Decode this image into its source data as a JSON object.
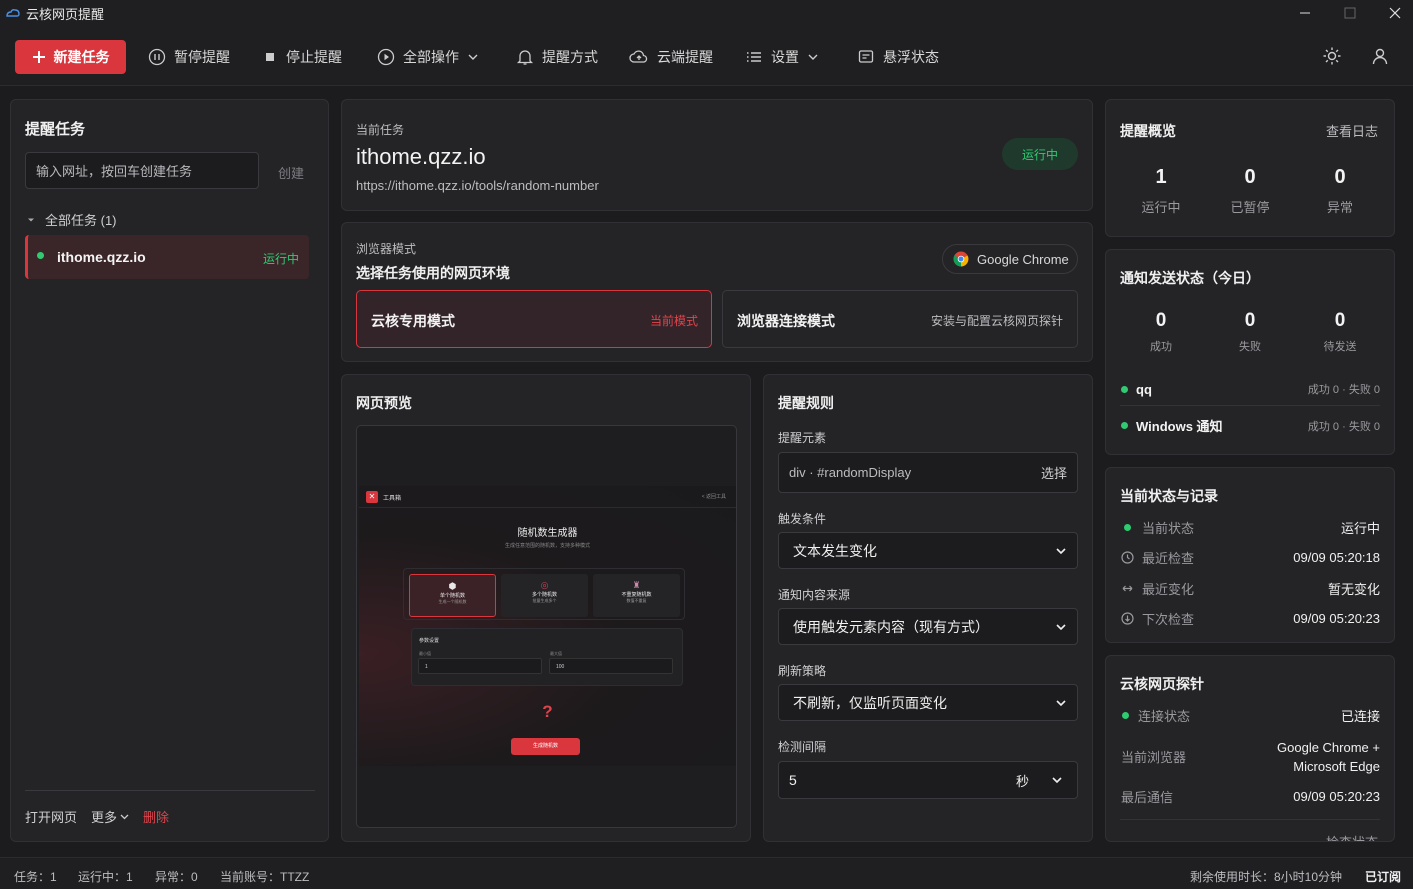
{
  "app": {
    "title": "云核网页提醒"
  },
  "toolbar": {
    "new_task": "新建任务",
    "pause": "暂停提醒",
    "stop": "停止提醒",
    "all_ops": "全部操作",
    "notify_method": "提醒方式",
    "cloud": "云端提醒",
    "settings": "设置",
    "float": "悬浮状态"
  },
  "left": {
    "title": "提醒任务",
    "url_placeholder": "输入网址，按回车创建任务",
    "create": "创建",
    "group": "全部任务 (1)",
    "task": {
      "name": "ithome.qzz.io",
      "status": "运行中"
    },
    "open": "打开网页",
    "more": "更多",
    "delete": "删除"
  },
  "current": {
    "label": "当前任务",
    "name": "ithome.qzz.io",
    "url": "https://ithome.qzz.io/tools/random-number",
    "status": "运行中"
  },
  "browser": {
    "label": "浏览器模式",
    "subtitle": "选择任务使用的网页环境",
    "browser_name": "Google Chrome",
    "mode1": "云核专用模式",
    "mode1_tag": "当前模式",
    "mode2": "浏览器连接模式",
    "mode2_desc": "安装与配置云核网页探针"
  },
  "preview": {
    "title": "网页预览",
    "site_name": "工具箱",
    "back": "< 返回工具",
    "page_title": "随机数生成器",
    "page_sub": "生成任意范围的随机数，支持多种模式",
    "opt1": "单个随机数",
    "opt1_sub": "生成一个随机数",
    "opt2": "多个随机数",
    "opt2_sub": "批量生成多个",
    "opt3": "不重复随机数",
    "opt3_sub": "数值不重复",
    "params": "参数设置",
    "min_label": "最小值",
    "max_label": "最大值",
    "min": "1",
    "max": "100",
    "question": "?",
    "gen_btn": "生成随机数"
  },
  "rules": {
    "title": "提醒规则",
    "element_label": "提醒元素",
    "element_value": "div · #randomDisplay",
    "select": "选择",
    "trigger_label": "触发条件",
    "trigger_value": "文本发生变化",
    "source_label": "通知内容来源",
    "source_value": "使用触发元素内容（现有方式）",
    "refresh_label": "刷新策略",
    "refresh_value": "不刷新，仅监听页面变化",
    "interval_label": "检测间隔",
    "interval_value": "5",
    "interval_unit": "秒"
  },
  "overview": {
    "title": "提醒概览",
    "log": "查看日志",
    "running": "1",
    "running_label": "运行中",
    "paused": "0",
    "paused_label": "已暂停",
    "error": "0",
    "error_label": "异常"
  },
  "notify": {
    "title": "通知发送状态（今日）",
    "success": "0",
    "success_label": "成功",
    "fail": "0",
    "fail_label": "失败",
    "pending": "0",
    "pending_label": "待发送",
    "ch1": "qq",
    "ch1_stat": "成功 0 · 失败 0",
    "ch2": "Windows 通知",
    "ch2_stat": "成功 0 · 失败 0"
  },
  "state": {
    "title": "当前状态与记录",
    "cur_label": "当前状态",
    "cur": "运行中",
    "last_label": "最近检查",
    "last": "09/09 05:20:18",
    "change_label": "最近变化",
    "change": "暂无变化",
    "next_label": "下次检查",
    "next": "09/09 05:20:23"
  },
  "probe": {
    "title": "云核网页探针",
    "conn_label": "连接状态",
    "conn": "已连接",
    "browser_label": "当前浏览器",
    "browser1": "Google Chrome +",
    "browser2": "Microsoft Edge",
    "comm_label": "最后通信",
    "comm": "09/09 05:20:23",
    "check": "检查状态"
  },
  "statusbar": {
    "tasks": "任务：1",
    "running": "运行中：1",
    "errors": "异常：0",
    "account": "当前账号：TTZZ",
    "remaining": "剩余使用时长：8小时10分钟",
    "subscribed": "已订阅"
  },
  "colors": {
    "accent": "#d9363e",
    "running": "#2ecc71"
  }
}
